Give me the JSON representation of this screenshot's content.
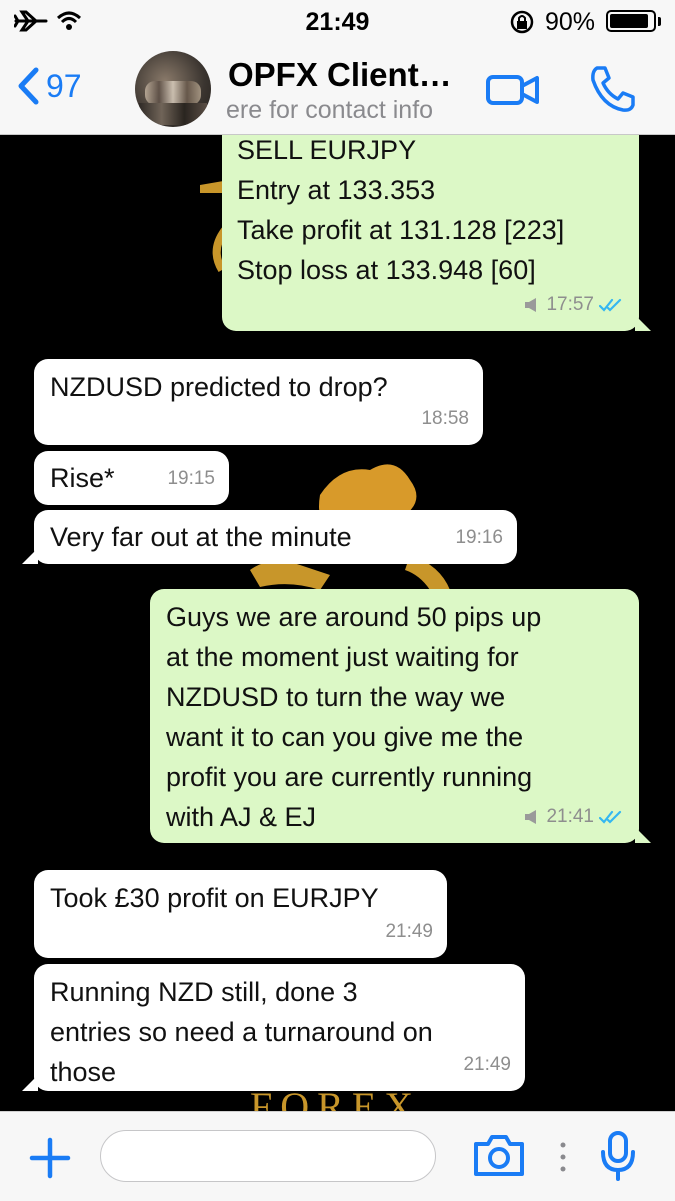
{
  "status_bar": {
    "time": "21:49",
    "battery_percent": "90%",
    "battery_level": 0.9
  },
  "header": {
    "back_count": "97",
    "title": "OPFX Client…",
    "subtitle": "ere for contact info",
    "accent_color": "#1a7cf5"
  },
  "messages": [
    {
      "direction": "outgoing",
      "text": "SELL EURJPY\nEntry at 133.353\nTake profit at 131.128 [223]\nStop loss at 133.948 [60]",
      "time": "17:57",
      "status": "read"
    },
    {
      "direction": "incoming",
      "text": "NZDUSD predicted to drop?",
      "time": "18:58"
    },
    {
      "direction": "incoming",
      "text": "Rise*",
      "time": "19:15"
    },
    {
      "direction": "incoming",
      "text": "Very far out at the minute",
      "time": "19:16"
    },
    {
      "direction": "outgoing",
      "text": "Guys we are around 50 pips up\nat the moment just waiting for\nNZDUSD to turn the way we\nwant it to can you give me the\nprofit you are currently running\nwith AJ & EJ",
      "time": "21:41",
      "status": "read"
    },
    {
      "direction": "incoming",
      "text": "Took £30 profit on EURJPY",
      "time": "21:49"
    },
    {
      "direction": "incoming",
      "text": "Running NZD still, done 3\nentries so need a turnaround on\nthose",
      "time": "21:49"
    }
  ],
  "wallpaper": {
    "text": "FOREX",
    "color": "#c8962a"
  },
  "input": {
    "placeholder": ""
  }
}
